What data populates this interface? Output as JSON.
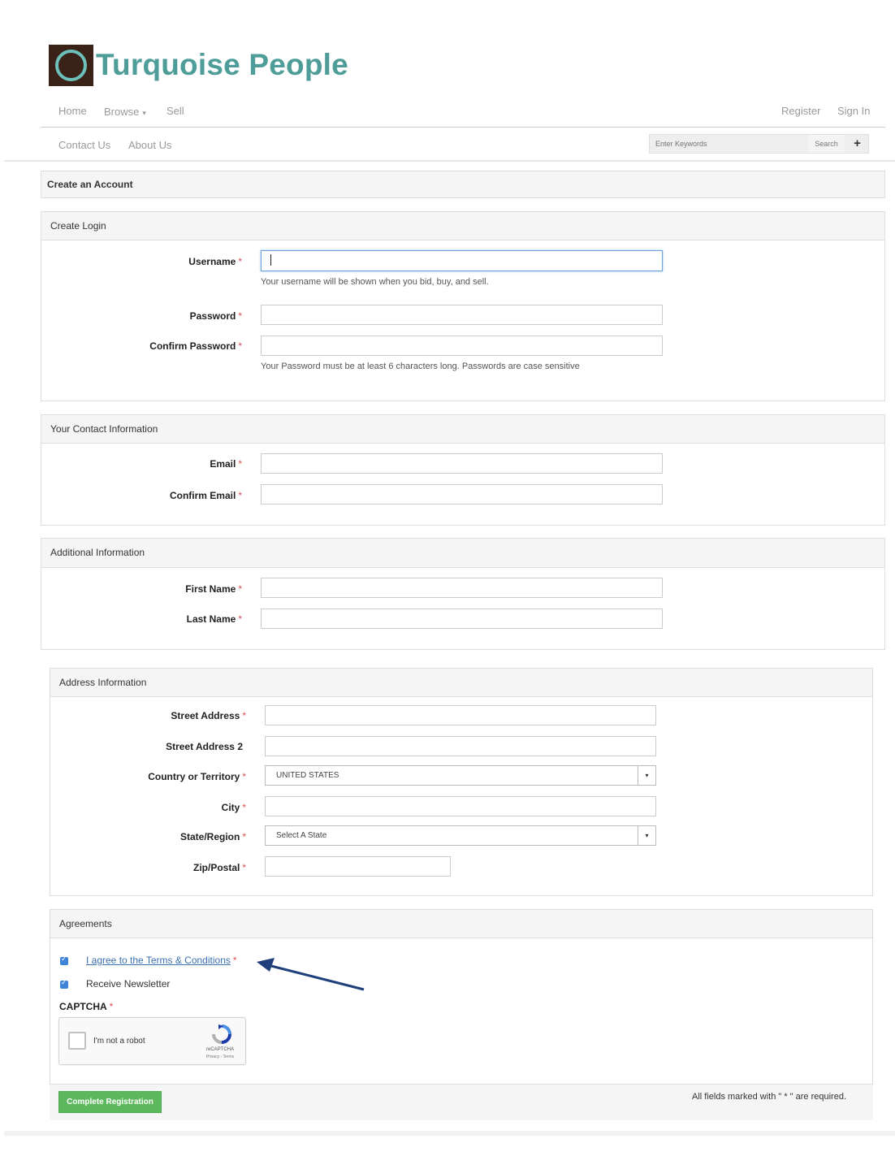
{
  "brand": {
    "name": "Turquoise People",
    "logo_color": "#3b2219",
    "accent": "#4f9d99"
  },
  "nav": {
    "primary": [
      {
        "label": "Home"
      },
      {
        "label": "Browse"
      },
      {
        "label": "Sell"
      }
    ],
    "auth": [
      {
        "label": "Register"
      },
      {
        "label": "Sign In"
      }
    ],
    "secondary": [
      {
        "label": "Contact Us"
      },
      {
        "label": "About Us"
      }
    ],
    "search": {
      "placeholder": "Enter Keywords",
      "button": "Search",
      "plus": "+"
    }
  },
  "page_title": "Create an Account",
  "create_login": {
    "heading": "Create Login",
    "username_label": "Username",
    "username_help": "Your username will be shown when you bid, buy, and sell.",
    "password_label": "Password",
    "confirm_password_label": "Confirm Password",
    "password_help": "Your Password must be at least 6 characters long. Passwords are case sensitive"
  },
  "contact": {
    "heading": "Your Contact Information",
    "email_label": "Email",
    "confirm_email_label": "Confirm Email"
  },
  "additional": {
    "heading": "Additional Information",
    "first_name_label": "First Name",
    "last_name_label": "Last Name"
  },
  "address": {
    "heading": "Address Information",
    "street_label": "Street Address",
    "street2_label": "Street Address 2",
    "country_label": "Country or Territory",
    "country_value": "UNITED STATES",
    "city_label": "City",
    "state_label": "State/Region",
    "state_value": "Select A State",
    "zip_label": "Zip/Postal"
  },
  "agreements": {
    "heading": "Agreements",
    "terms_label": "I agree to the Terms & Conditions",
    "newsletter_label": "Receive Newsletter",
    "captcha_label": "CAPTCHA",
    "captcha_text": "I'm not a robot",
    "recaptcha_brand": "reCAPTCHA",
    "recaptcha_links": "Privacy - Terms"
  },
  "required_marker": "*",
  "submit_label": "Complete Registration",
  "required_note": "All fields marked with \" * \" are required.",
  "colors": {
    "required": "#d9534f",
    "submit": "#5cb85c",
    "link": "#3a6fb0",
    "arrow": "#1f3f7a"
  }
}
